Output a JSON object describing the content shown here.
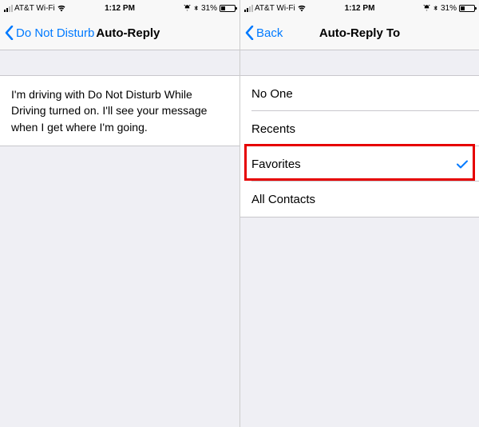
{
  "status": {
    "carrier": "AT&T Wi-Fi",
    "time": "1:12 PM",
    "battery_pct": "31%"
  },
  "left": {
    "back_label": "Do Not Disturb",
    "title": "Auto-Reply",
    "message": "I'm driving with Do Not Disturb While Driving turned on. I'll see your message when I get where I'm going."
  },
  "right": {
    "back_label": "Back",
    "title": "Auto-Reply To",
    "options": {
      "0": "No One",
      "1": "Recents",
      "2": "Favorites",
      "3": "All Contacts"
    },
    "selected_index": 2
  }
}
